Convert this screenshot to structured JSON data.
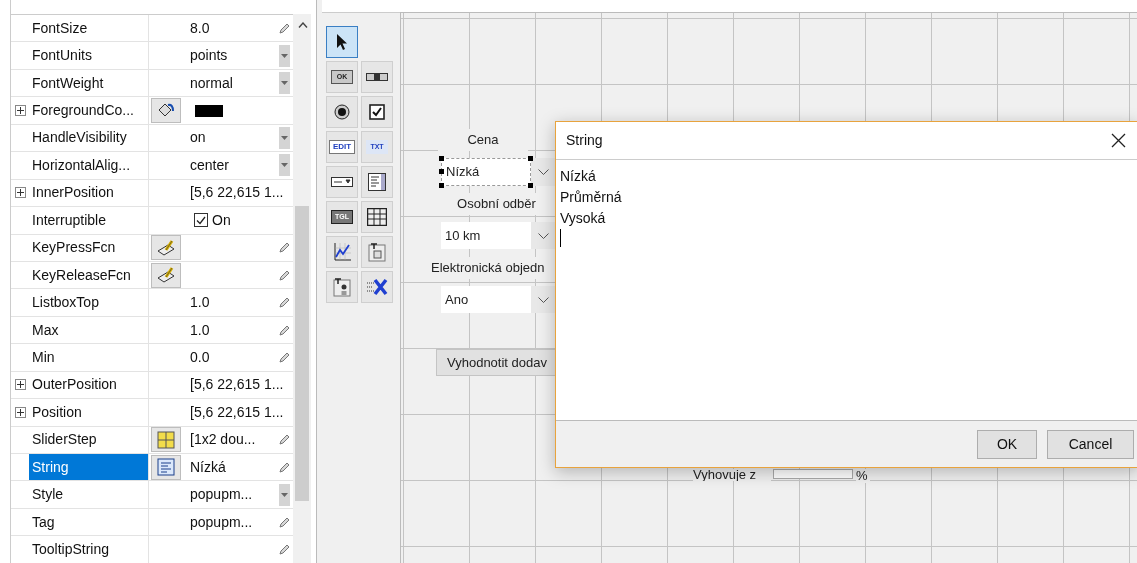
{
  "inspector": {
    "rows": [
      {
        "name": "FontSize",
        "expandable": false,
        "selected": false,
        "value": {
          "kind": "text",
          "text": "8.0"
        },
        "trailing": {
          "kind": "pencil"
        }
      },
      {
        "name": "FontUnits",
        "expandable": false,
        "selected": false,
        "value": {
          "kind": "text",
          "text": "points"
        },
        "trailing": {
          "kind": "dropdown"
        }
      },
      {
        "name": "FontWeight",
        "expandable": false,
        "selected": false,
        "value": {
          "kind": "text",
          "text": "normal"
        },
        "trailing": {
          "kind": "dropdown"
        }
      },
      {
        "name": "ForegroundCo...",
        "expandable": true,
        "selected": false,
        "editor": {
          "kind": "color"
        },
        "value": {
          "kind": "swatch",
          "color": "#000000"
        }
      },
      {
        "name": "HandleVisibility",
        "expandable": false,
        "selected": false,
        "value": {
          "kind": "text",
          "text": "on"
        },
        "trailing": {
          "kind": "dropdown"
        }
      },
      {
        "name": "HorizontalAlig...",
        "expandable": false,
        "selected": false,
        "value": {
          "kind": "text",
          "text": "center"
        },
        "trailing": {
          "kind": "dropdown"
        }
      },
      {
        "name": "InnerPosition",
        "expandable": true,
        "selected": false,
        "value": {
          "kind": "text",
          "text": "[5,6 22,615 1..."
        }
      },
      {
        "name": "Interruptible",
        "expandable": false,
        "selected": false,
        "value": {
          "kind": "checkbox",
          "checked": true,
          "text": "On"
        }
      },
      {
        "name": "KeyPressFcn",
        "expandable": false,
        "selected": false,
        "editor": {
          "kind": "callback"
        },
        "trailing": {
          "kind": "pencil"
        }
      },
      {
        "name": "KeyReleaseFcn",
        "expandable": false,
        "selected": false,
        "editor": {
          "kind": "callback"
        },
        "trailing": {
          "kind": "pencil"
        }
      },
      {
        "name": "ListboxTop",
        "expandable": false,
        "selected": false,
        "value": {
          "kind": "text",
          "text": "1.0"
        },
        "trailing": {
          "kind": "pencil"
        }
      },
      {
        "name": "Max",
        "expandable": false,
        "selected": false,
        "value": {
          "kind": "text",
          "text": "1.0"
        },
        "trailing": {
          "kind": "pencil"
        }
      },
      {
        "name": "Min",
        "expandable": false,
        "selected": false,
        "value": {
          "kind": "text",
          "text": "0.0"
        },
        "trailing": {
          "kind": "pencil"
        }
      },
      {
        "name": "OuterPosition",
        "expandable": true,
        "selected": false,
        "value": {
          "kind": "text",
          "text": "[5,6 22,615 1..."
        }
      },
      {
        "name": "Position",
        "expandable": true,
        "selected": false,
        "value": {
          "kind": "text",
          "text": "[5,6 22,615 1..."
        }
      },
      {
        "name": "SliderStep",
        "expandable": false,
        "selected": false,
        "editor": {
          "kind": "grid"
        },
        "value": {
          "kind": "text",
          "text": "[1x2  dou..."
        },
        "trailing": {
          "kind": "pencil"
        }
      },
      {
        "name": "String",
        "expandable": false,
        "selected": true,
        "editor": {
          "kind": "list"
        },
        "value": {
          "kind": "text",
          "text": "Nízká"
        },
        "trailing": {
          "kind": "pencil"
        }
      },
      {
        "name": "Style",
        "expandable": false,
        "selected": false,
        "value": {
          "kind": "text",
          "text": "popupm..."
        },
        "trailing": {
          "kind": "dropdown"
        }
      },
      {
        "name": "Tag",
        "expandable": false,
        "selected": false,
        "value": {
          "kind": "text",
          "text": "popupm..."
        },
        "trailing": {
          "kind": "pencil"
        }
      },
      {
        "name": "TooltipString",
        "expandable": false,
        "selected": false,
        "trailing": {
          "kind": "pencil"
        }
      }
    ]
  },
  "palette": {
    "tools": [
      {
        "kind": "pointer",
        "selected": true
      },
      {
        "kind": "pushbutton",
        "label": "OK",
        "selected": false
      },
      {
        "kind": "slider",
        "selected": false
      },
      {
        "kind": "radio",
        "selected": false
      },
      {
        "kind": "checkbox",
        "selected": false
      },
      {
        "kind": "edit",
        "label": "EDIT",
        "selected": false
      },
      {
        "kind": "text",
        "label": "TXT",
        "selected": false
      },
      {
        "kind": "popup",
        "selected": false
      },
      {
        "kind": "listbox",
        "selected": false
      },
      {
        "kind": "toggle",
        "label": "TGL",
        "selected": false
      },
      {
        "kind": "table",
        "selected": false
      },
      {
        "kind": "axes",
        "selected": false
      },
      {
        "kind": "panel",
        "selected": false
      },
      {
        "kind": "buttongroup",
        "selected": false
      },
      {
        "kind": "activex",
        "selected": false
      }
    ]
  },
  "canvas": {
    "components": [
      {
        "kind": "label",
        "text": "Cena"
      },
      {
        "kind": "popup",
        "text": "Nízká",
        "selected": true
      },
      {
        "kind": "label",
        "text": "Osobní odběr"
      },
      {
        "kind": "popup",
        "text": "10 km",
        "selected": false
      },
      {
        "kind": "label",
        "text": "Elektronická objedn"
      },
      {
        "kind": "popup",
        "text": "Ano",
        "selected": false
      },
      {
        "kind": "button",
        "text": "Vyhodnotit dodav"
      },
      {
        "kind": "label",
        "text": "Vyhovuje z"
      },
      {
        "kind": "field"
      },
      {
        "kind": "label",
        "text": "%"
      }
    ]
  },
  "dialog": {
    "title": "String",
    "lines": [
      "Nízká",
      "Průměrná",
      "Vysoká"
    ],
    "caret_visible": true,
    "buttons": [
      "OK",
      "Cancel"
    ]
  }
}
